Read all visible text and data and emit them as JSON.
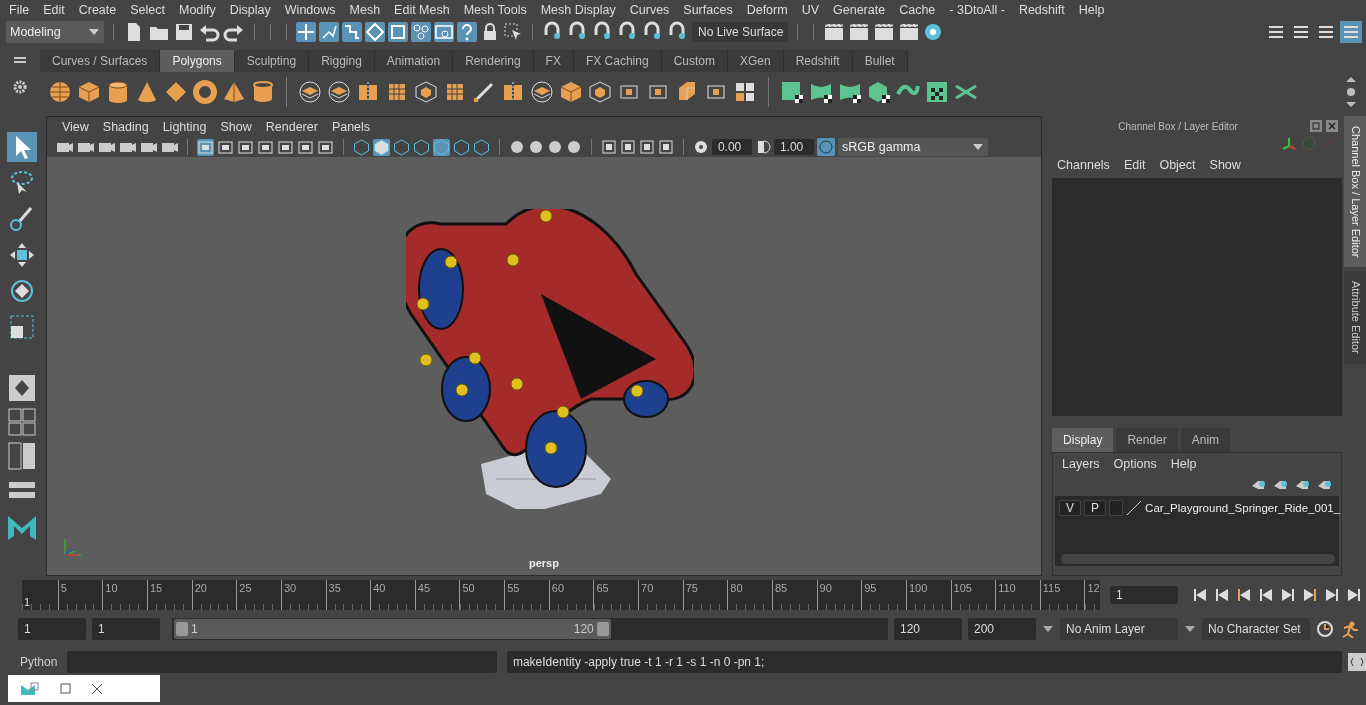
{
  "menu_bar": [
    "File",
    "Edit",
    "Create",
    "Select",
    "Modify",
    "Display",
    "Windows",
    "Mesh",
    "Edit Mesh",
    "Mesh Tools",
    "Mesh Display",
    "Curves",
    "Surfaces",
    "Deform",
    "UV",
    "Generate",
    "Cache",
    "- 3DtoAll -",
    "Redshift",
    "Help"
  ],
  "status_line": {
    "mode": "Modeling",
    "selection_masks": [
      {
        "on": true
      },
      {
        "on": true
      },
      {
        "on": true
      },
      {
        "on": true
      },
      {
        "on": true
      },
      {
        "on": true
      },
      {
        "on": true
      },
      {
        "on": true
      }
    ],
    "live_surface": "No Live Surface"
  },
  "shelf": {
    "tabs": [
      {
        "label": "Curves / Surfaces",
        "selected": false
      },
      {
        "label": "Polygons",
        "selected": true
      },
      {
        "label": "Sculpting",
        "selected": false
      },
      {
        "label": "Rigging",
        "selected": false
      },
      {
        "label": "Animation",
        "selected": false
      },
      {
        "label": "Rendering",
        "selected": false
      },
      {
        "label": "FX",
        "selected": false
      },
      {
        "label": "FX Caching",
        "selected": false
      },
      {
        "label": "Custom",
        "selected": false
      },
      {
        "label": "XGen",
        "selected": false
      },
      {
        "label": "Redshift",
        "selected": false
      },
      {
        "label": "Bullet",
        "selected": false
      }
    ]
  },
  "viewport": {
    "menus": [
      "View",
      "Shading",
      "Lighting",
      "Show",
      "Renderer",
      "Panels"
    ],
    "toggles": [
      {
        "on": true
      },
      {
        "on": false
      },
      {
        "on": false
      },
      {
        "on": false
      },
      {
        "on": false
      },
      {
        "on": false
      },
      {
        "on": false
      },
      {
        "on": false
      },
      {
        "on": true
      },
      {
        "on": false
      },
      {
        "on": false
      },
      {
        "on": true
      },
      {
        "on": false
      },
      {
        "on": false
      }
    ],
    "exposure": "0.00",
    "gamma": "1.00",
    "color_management_on": true,
    "color_space": "sRGB gamma",
    "camera": "persp"
  },
  "channel_box": {
    "title": "Channel Box / Layer Editor",
    "menus": [
      "Channels",
      "Edit",
      "Object",
      "Show"
    ]
  },
  "layer_editor": {
    "tabs": [
      {
        "label": "Display",
        "selected": true
      },
      {
        "label": "Render",
        "selected": false
      },
      {
        "label": "Anim",
        "selected": false
      }
    ],
    "menus": [
      "Layers",
      "Options",
      "Help"
    ],
    "layers": [
      {
        "visibility": "V",
        "playback": "P",
        "name": "Car_Playground_Springer_Ride_001_"
      }
    ]
  },
  "side_tabs": [
    {
      "label": "Channel Box / Layer Editor",
      "selected": true
    },
    {
      "label": "Attribute Editor",
      "selected": false
    }
  ],
  "timeline": {
    "start_label": "1",
    "ticks": [
      "5",
      "10",
      "15",
      "20",
      "25",
      "30",
      "35",
      "40",
      "45",
      "50",
      "55",
      "60",
      "65",
      "70",
      "75",
      "80",
      "85",
      "90",
      "95",
      "100",
      "105",
      "110",
      "115",
      "12"
    ],
    "current_frame": "1"
  },
  "range": {
    "level": 0.61,
    "start": "1",
    "playback_start": "1",
    "slider_start": "1",
    "slider_end": "120",
    "playback_end": "120",
    "end": "200",
    "anim_layer": "No Anim Layer",
    "character_set": "No Character Set"
  },
  "command_line": {
    "language": "Python",
    "result": "makeIdentity -apply true -t 1 -r 1 -s 1 -n 0 -pn 1;"
  }
}
